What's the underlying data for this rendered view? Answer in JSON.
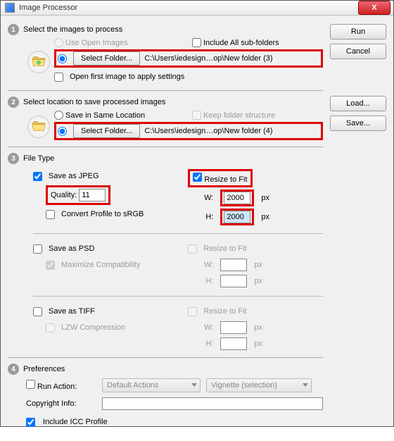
{
  "window": {
    "title": "Image Processor",
    "close": "X"
  },
  "buttons": {
    "run": "Run",
    "cancel": "Cancel",
    "load": "Load...",
    "save": "Save..."
  },
  "s1": {
    "num": "1",
    "title": "Select the images to process",
    "use_open": "Use Open Images",
    "include_sub": "Include All sub-folders",
    "select_folder": "Select Folder...",
    "path": "C:\\Users\\iedesign…op\\New folder (3)",
    "open_first": "Open first image to apply settings"
  },
  "s2": {
    "num": "2",
    "title": "Select location to save processed images",
    "save_same": "Save in Same Location",
    "keep_struct": "Keep folder structure",
    "select_folder": "Select Folder...",
    "path": "C:\\Users\\iedesign…op\\New folder (4)"
  },
  "s3": {
    "num": "3",
    "title": "File Type",
    "jpeg": {
      "save": "Save as JPEG",
      "quality_label": "Quality:",
      "quality_value": "11",
      "convert": "Convert Profile to sRGB",
      "resize": "Resize to Fit",
      "w_label": "W:",
      "w_value": "2000",
      "h_label": "H:",
      "h_value": "2000",
      "px": "px"
    },
    "psd": {
      "save": "Save as PSD",
      "max": "Maximize Compatibility",
      "resize": "Resize to Fit",
      "w_label": "W:",
      "h_label": "H:",
      "px": "px"
    },
    "tiff": {
      "save": "Save as TIFF",
      "lzw": "LZW Compression",
      "resize": "Resize to Fit",
      "w_label": "W:",
      "h_label": "H:",
      "px": "px"
    }
  },
  "s4": {
    "num": "4",
    "title": "Preferences",
    "run_action": "Run Action:",
    "action_set": "Default Actions",
    "action": "Vignette (selection)",
    "copyright": "Copyright Info:",
    "include_icc": "Include ICC Profile"
  }
}
